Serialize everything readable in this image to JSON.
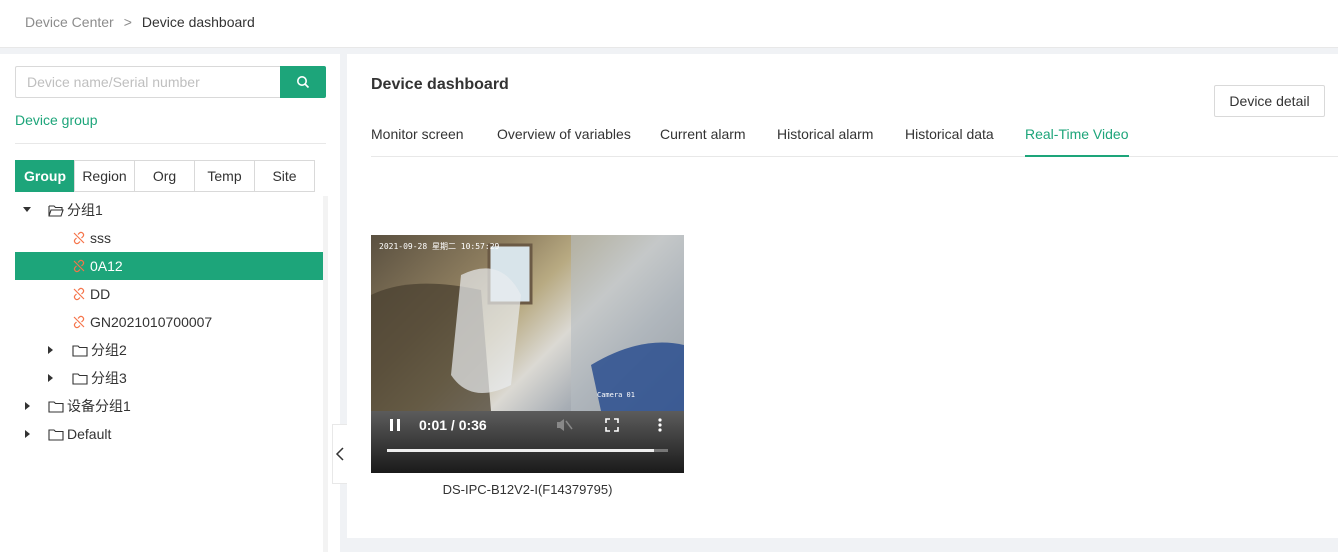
{
  "breadcrumb": {
    "parent": "Device Center",
    "separator": ">",
    "current": "Device dashboard"
  },
  "search": {
    "placeholder": "Device name/Serial number"
  },
  "left_tab": "Device group",
  "segments": [
    "Group",
    "Region",
    "Org",
    "Temp",
    "Site"
  ],
  "tree": {
    "group1": "分组1",
    "devices": [
      "sss",
      "0A12",
      "DD",
      "GN2021010700007"
    ],
    "group2": "分组2",
    "group3": "分组3",
    "devgroup1": "设备分组1",
    "default": "Default"
  },
  "main": {
    "title": "Device dashboard",
    "detail_button": "Device detail",
    "tabs": [
      "Monitor screen",
      "Overview of variables",
      "Current alarm",
      "Historical alarm",
      "Historical data",
      "Real-Time Video"
    ],
    "active_tab": "Real-Time Video"
  },
  "video": {
    "osd_text": "2021-09-28 星期二 10:57:29",
    "camera_label": "Camera 01",
    "time": "0:01 / 0:36",
    "progress": 0.95,
    "caption": "DS-IPC-B12V2-I(F14379795)"
  },
  "colors": {
    "accent": "#1da57a",
    "offline_icon": "#f5744a"
  }
}
